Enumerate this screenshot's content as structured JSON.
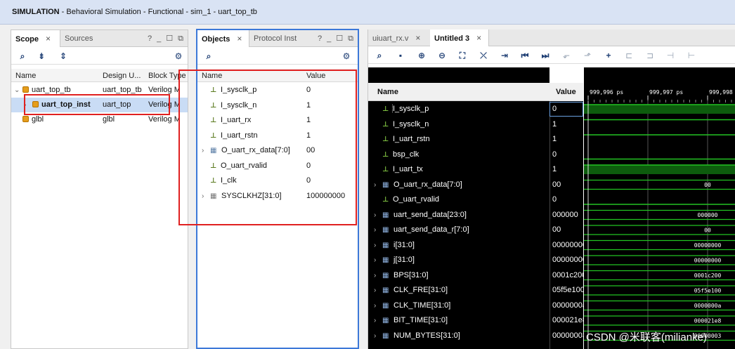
{
  "title": {
    "prefix": "SIMULATION",
    "rest": " - Behavioral Simulation - Functional - sim_1 - uart_top_tb"
  },
  "scope": {
    "tabs": [
      {
        "label": "Scope"
      },
      {
        "label": "Sources"
      }
    ],
    "columns": [
      "Name",
      "Design U...",
      "Block Type"
    ],
    "rows": [
      {
        "name": "uart_top_tb",
        "unit": "uart_top_tb",
        "type": "Verilog M"
      },
      {
        "name": "uart_top_inst",
        "unit": "uart_top",
        "type": "Verilog M"
      },
      {
        "name": "glbl",
        "unit": "glbl",
        "type": "Verilog M"
      }
    ]
  },
  "objects": {
    "tabs": [
      {
        "label": "Objects"
      },
      {
        "label": "Protocol Inst"
      }
    ],
    "columns": [
      "Name",
      "Value"
    ],
    "rows": [
      {
        "name": "I_sysclk_p",
        "value": "0",
        "kind": "sig"
      },
      {
        "name": "I_sysclk_n",
        "value": "1",
        "kind": "sig"
      },
      {
        "name": "I_uart_rx",
        "value": "1",
        "kind": "sig"
      },
      {
        "name": "I_uart_rstn",
        "value": "1",
        "kind": "sig"
      },
      {
        "name": "O_uart_rx_data[7:0]",
        "value": "00",
        "kind": "bus"
      },
      {
        "name": "O_uart_rvalid",
        "value": "0",
        "kind": "sig"
      },
      {
        "name": "I_clk",
        "value": "0",
        "kind": "sig"
      },
      {
        "name": "SYSCLKHZ[31:0]",
        "value": "100000000",
        "kind": "param"
      }
    ]
  },
  "wave": {
    "tabs": [
      {
        "label": "uiuart_rx.v"
      },
      {
        "label": "Untitled 3"
      }
    ],
    "columns": [
      "Name",
      "Value"
    ],
    "time_labels": [
      "999,996 ps",
      "999,997 ps",
      "999,998"
    ],
    "rows": [
      {
        "name": "I_sysclk_p",
        "value": "0",
        "kind": "sig",
        "wave": "high-fill"
      },
      {
        "name": "I_sysclk_n",
        "value": "1",
        "kind": "sig",
        "wave": "high"
      },
      {
        "name": "I_uart_rstn",
        "value": "1",
        "kind": "sig",
        "wave": "high"
      },
      {
        "name": "bsp_clk",
        "value": "0",
        "kind": "sig",
        "wave": "low"
      },
      {
        "name": "I_uart_tx",
        "value": "1",
        "kind": "sig",
        "wave": "high-fill"
      },
      {
        "name": "O_uart_rx_data[7:0]",
        "value": "00",
        "kind": "bus",
        "wave": "bus",
        "wave_label": "00"
      },
      {
        "name": "O_uart_rvalid",
        "value": "0",
        "kind": "sig",
        "wave": "low"
      },
      {
        "name": "uart_send_data[23:0]",
        "value": "000000",
        "kind": "bus",
        "wave": "bus",
        "wave_label": "000000"
      },
      {
        "name": "uart_send_data_r[7:0]",
        "value": "00",
        "kind": "bus",
        "wave": "bus",
        "wave_label": "00"
      },
      {
        "name": "i[31:0]",
        "value": "00000000",
        "kind": "bus",
        "wave": "bus",
        "wave_label": "00000000"
      },
      {
        "name": "j[31:0]",
        "value": "00000000",
        "kind": "bus",
        "wave": "bus",
        "wave_label": "00000000"
      },
      {
        "name": "BPS[31:0]",
        "value": "0001c200",
        "kind": "bus",
        "wave": "bus",
        "wave_label": "0001c200"
      },
      {
        "name": "CLK_FRE[31:0]",
        "value": "05f5e100",
        "kind": "bus",
        "wave": "bus",
        "wave_label": "05f5e100"
      },
      {
        "name": "CLK_TIME[31:0]",
        "value": "0000000a",
        "kind": "bus",
        "wave": "bus",
        "wave_label": "0000000a"
      },
      {
        "name": "BIT_TIME[31:0]",
        "value": "000021e8",
        "kind": "bus",
        "wave": "bus",
        "wave_label": "000021e8"
      },
      {
        "name": "NUM_BYTES[31:0]",
        "value": "00000003",
        "kind": "bus",
        "wave": "bus",
        "wave_label": "00000003"
      }
    ]
  },
  "watermark": "CSDN @米联客(milianke)",
  "colors": {
    "wave_green": "#22c322",
    "wave_fill": "#0d5c0d",
    "highlight_red": "#e02020",
    "objects_border": "#3c78d8"
  }
}
